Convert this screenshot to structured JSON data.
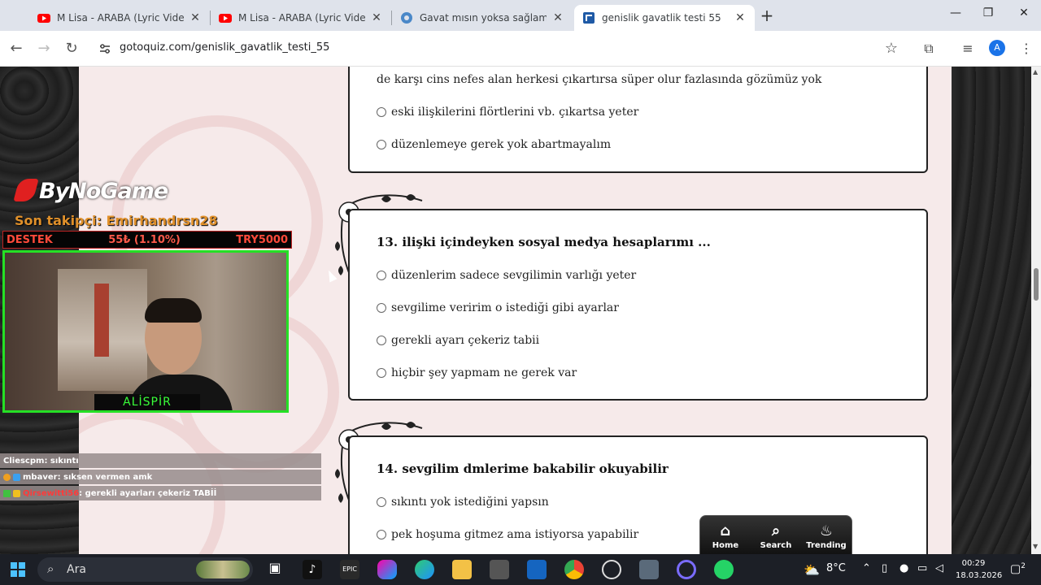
{
  "browser": {
    "tabs": [
      {
        "title": "M Lisa - ARABA (Lyric Video) - Y",
        "icon": "youtube-icon",
        "active": false
      },
      {
        "title": "M Lisa - ARABA (Lyric Video) - Y",
        "icon": "youtube-icon",
        "active": false
      },
      {
        "title": "Gavat mısın yoksa sağlam bir g",
        "icon": "chatgpt-icon",
        "active": false
      },
      {
        "title": "genislik gavatlik testi 55",
        "icon": "gotoquiz-icon",
        "active": true
      }
    ],
    "url": "gotoquiz.com/genislik_gavatlik_testi_55",
    "profile_initial": "A"
  },
  "quiz": {
    "prev_question_tail": "de karşı cins nefes alan herkesi çıkartırsa süper olur fazlasında gözümüz yok",
    "prev_options": [
      "eski ilişkilerini flörtlerini vb. çıkartsa yeter",
      "düzenlemeye gerek yok abartmayalım"
    ],
    "q13": {
      "title": "13. ilişki içindeyken sosyal medya hesaplarımı ...",
      "options": [
        "düzenlerim sadece sevgilimin varlığı yeter",
        "sevgilime veririm o istediği gibi ayarlar",
        "gerekli ayarı çekeriz tabii",
        "hiçbir şey yapmam ne gerek var"
      ]
    },
    "q14": {
      "title": "14. sevgilim dmlerime bakabilir okuyabilir",
      "options": [
        "sıkıntı yok istediğini yapsın",
        "pek hoşuma gitmez ama istiyorsa yapabilir"
      ]
    }
  },
  "mini_nav": {
    "home": "Home",
    "search": "Search",
    "trending": "Trending"
  },
  "stream": {
    "brand": "ByNoGame",
    "last_follower": "Son takipçi: Emirhandrsn28",
    "destek_label": "DESTEK",
    "destek_amount": "55₺ (1.10%)",
    "destek_goal": "TRY5000",
    "streamer_name": "ALİSPİR",
    "chat": [
      {
        "user": "Cliescpm",
        "message": " : sıkıntı"
      },
      {
        "user": "mbaver",
        "message": " : sıksen vermen amk"
      },
      {
        "user": "Qirsewitti56",
        "message": " : gerekli ayarları çekeriz TABİİ"
      }
    ]
  },
  "taskbar": {
    "search_label": "Ara",
    "temperature": "8°C",
    "time": "00:29",
    "date": "18.03.2026",
    "notification_count": "2"
  }
}
